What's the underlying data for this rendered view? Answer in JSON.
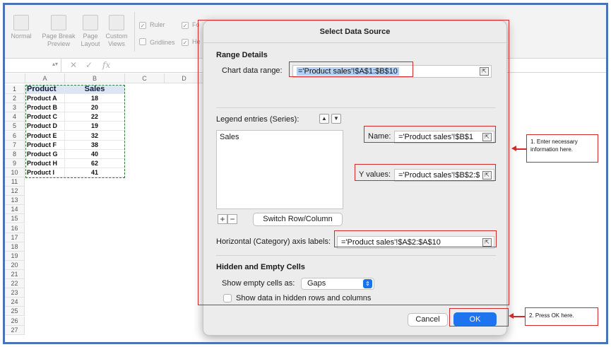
{
  "ribbon": {
    "view_buttons": [
      {
        "label": "Normal"
      },
      {
        "label": "Page Break Preview"
      },
      {
        "label": "Page Layout"
      },
      {
        "label": "Custom Views"
      }
    ],
    "checkboxes": [
      {
        "label": "Ruler",
        "checked": true
      },
      {
        "label": "Gridlines",
        "checked": false
      }
    ],
    "fo_partial": "Fo",
    "he_partial": "He"
  },
  "formula_bar": {
    "name_box": "",
    "cancel_symbol": "✕",
    "confirm_symbol": "✓",
    "fx_symbol": "fx"
  },
  "sheet": {
    "columns": [
      "A",
      "B",
      "C",
      "D"
    ],
    "rows": [
      "1",
      "2",
      "3",
      "4",
      "5",
      "6",
      "7",
      "8",
      "9",
      "10",
      "11",
      "12",
      "13",
      "14",
      "15",
      "16",
      "17",
      "18",
      "19",
      "20",
      "21",
      "22",
      "23",
      "24",
      "25",
      "26",
      "27"
    ],
    "header": [
      "Product",
      "Sales"
    ],
    "data": [
      [
        "Product A",
        "18"
      ],
      [
        "Product B",
        "20"
      ],
      [
        "Product C",
        "22"
      ],
      [
        "Product D",
        "19"
      ],
      [
        "Product E",
        "32"
      ],
      [
        "Product F",
        "38"
      ],
      [
        "Product G",
        "40"
      ],
      [
        "Product H",
        "62"
      ],
      [
        "Product I",
        "41"
      ]
    ]
  },
  "dialog": {
    "title": "Select Data Source",
    "range_details_title": "Range Details",
    "chart_data_range_label": "Chart data range:",
    "chart_data_range_value": "='Product sales'!$A$1:$B$10",
    "legend_entries_label": "Legend entries (Series):",
    "series": [
      "Sales"
    ],
    "name_label": "Name:",
    "name_value": "='Product sales'!$B$1",
    "y_values_label": "Y values:",
    "y_values_value": "='Product sales'!$B$2:$",
    "add_symbol": "+",
    "remove_symbol": "−",
    "switch_button": "Switch Row/Column",
    "axis_labels_label": "Horizontal (Category) axis labels:",
    "axis_labels_value": "='Product sales'!$A$2:$A$10",
    "hidden_empty_title": "Hidden and Empty Cells",
    "show_empty_label": "Show empty cells as:",
    "show_empty_value": "Gaps",
    "show_hidden_label": "Show data in hidden rows and columns",
    "show_hidden_checked": false,
    "cancel_button": "Cancel",
    "ok_button": "OK"
  },
  "annotations": {
    "callout_1": "1. Enter necessary information here.",
    "callout_2": "2. Press OK here."
  },
  "colors": {
    "frame_border": "#4a72b8",
    "annotation_red": "#d12a2a",
    "ok_blue": "#1e74ee",
    "header_fill": "#dce6f2"
  }
}
